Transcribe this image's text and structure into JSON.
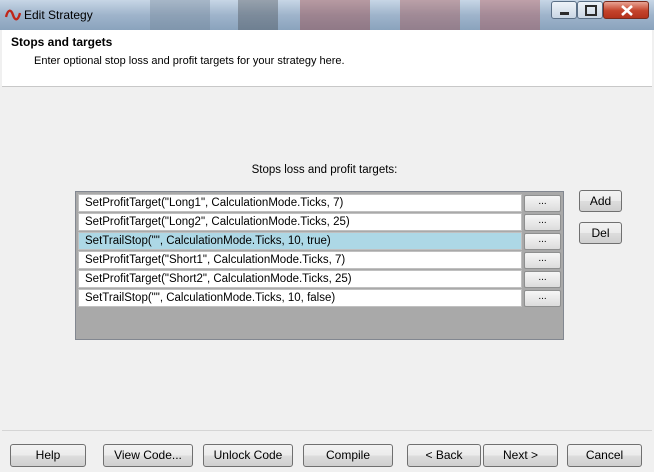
{
  "window": {
    "title": "Edit Strategy"
  },
  "header": {
    "title": "Stops and targets",
    "subtitle": "Enter optional stop loss and profit targets for your strategy here."
  },
  "panel": {
    "label": "Stops loss and profit targets:",
    "rows": [
      {
        "text": "SetProfitTarget(\"Long1\", CalculationMode.Ticks, 7)",
        "button": "...",
        "selected": false
      },
      {
        "text": "SetProfitTarget(\"Long2\", CalculationMode.Ticks, 25)",
        "button": "...",
        "selected": false
      },
      {
        "text": "SetTrailStop(\"\", CalculationMode.Ticks, 10, true)",
        "button": "...",
        "selected": true
      },
      {
        "text": "SetProfitTarget(\"Short1\", CalculationMode.Ticks, 7)",
        "button": "...",
        "selected": false
      },
      {
        "text": "SetProfitTarget(\"Short2\", CalculationMode.Ticks, 25)",
        "button": "...",
        "selected": false
      },
      {
        "text": "SetTrailStop(\"\", CalculationMode.Ticks, 10, false)",
        "button": "...",
        "selected": false
      }
    ],
    "add_label": "Add",
    "del_label": "Del"
  },
  "footer": {
    "help": "Help",
    "view_code": "View Code...",
    "unlock_code": "Unlock Code",
    "compile": "Compile",
    "back": "< Back",
    "next": "Next >",
    "cancel": "Cancel"
  },
  "colors": {
    "selected_row": "#add8e6",
    "list_background": "#a9a9a9",
    "close_button": "#c4432b"
  }
}
